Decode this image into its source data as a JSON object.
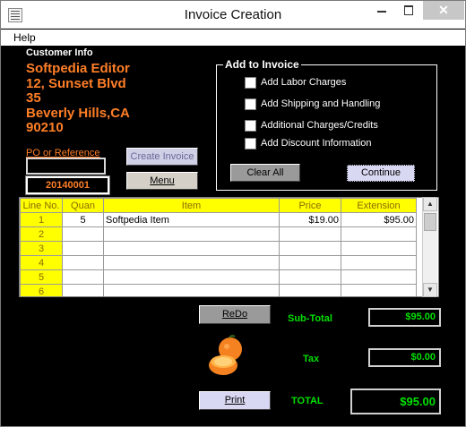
{
  "window": {
    "title": "Invoice Creation"
  },
  "menu": {
    "help": "Help"
  },
  "customer": {
    "label": "Customer Info",
    "lines": [
      "Softpedia Editor",
      "12, Sunset Blvd",
      "35",
      "Beverly Hills,CA",
      "90210"
    ]
  },
  "po": {
    "label": "PO or Reference",
    "value": "",
    "number": "20140001"
  },
  "buttons": {
    "create_invoice": "Create Invoice",
    "menu": "Menu",
    "clear_all": "Clear All",
    "continue": "Continue",
    "redo": "ReDo",
    "print": "Print"
  },
  "add_to_invoice": {
    "title": "Add to Invoice",
    "options": [
      {
        "label": "Add Labor Charges",
        "checked": false
      },
      {
        "label": "Add Shipping and Handling",
        "checked": false
      },
      {
        "label": "Additional Charges/Credits",
        "checked": false
      },
      {
        "label": "Add Discount Information",
        "checked": false
      }
    ]
  },
  "table": {
    "headers": [
      "Line No.",
      "Quan",
      "Item",
      "Price",
      "Extension"
    ],
    "rows": [
      {
        "line": "1",
        "quan": "5",
        "item": "Softpedia Item",
        "price": "$19.00",
        "extension": "$95.00"
      },
      {
        "line": "2",
        "quan": "",
        "item": "",
        "price": "",
        "extension": ""
      },
      {
        "line": "3",
        "quan": "",
        "item": "",
        "price": "",
        "extension": ""
      },
      {
        "line": "4",
        "quan": "",
        "item": "",
        "price": "",
        "extension": ""
      },
      {
        "line": "5",
        "quan": "",
        "item": "",
        "price": "",
        "extension": ""
      },
      {
        "line": "6",
        "quan": "",
        "item": "",
        "price": "",
        "extension": ""
      }
    ]
  },
  "totals": {
    "subtotal_label": "Sub-Total",
    "subtotal": "$95.00",
    "tax_label": "Tax",
    "tax": "$0.00",
    "total_label": "TOTAL",
    "total": "$95.00"
  },
  "icons": {
    "app": "invoice-app-icon",
    "logo": "orange-icon"
  },
  "colors": {
    "accent_orange": "#ff7f27",
    "totals_green": "#00e000",
    "header_yellow": "#ffff00"
  }
}
